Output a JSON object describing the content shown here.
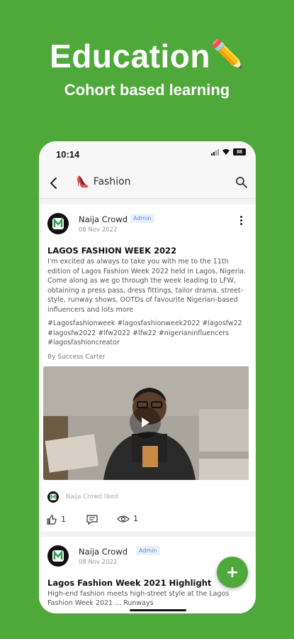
{
  "hero": {
    "title": "Education",
    "pencil": "✏️",
    "subtitle": "Cohort based learning"
  },
  "status_bar": {
    "time": "10:14",
    "battery": "88"
  },
  "app_bar": {
    "emoji": "👠",
    "title": "Fashion"
  },
  "posts": [
    {
      "author": "Naija Crowd",
      "badge": "Admin",
      "date": "08 Nov 2022",
      "title": "LAGOS FASHION WEEK 2022",
      "body": "I'm excited as always to take you with me to the 11th edition of Lagos Fashion Week 2022 held in Lagos, Nigeria. Come along as we go through the week leading to LFW, obtaining a press pass, dress fittings, tailor drama, street-style, runway shows, OOTDs of favourite Nigerian-based influencers and lots more",
      "tags": "#Lagosfashionweek #lagosfashionweek2022 #lagosfw22 #lagosfw2022 #lfw2022 #lfw22 #nigerianinfluencers #lagosfashioncreator",
      "byline": "By Success Carter",
      "liked_by": "Naija Crowd liked",
      "likes": "1",
      "views": "1"
    },
    {
      "author": "Naija Crowd",
      "badge": "Admin",
      "date": "08 Nov 2022",
      "title": "Lagos Fashion Week 2021 Highlight",
      "body": "High-end fashion meets high-street style at the Lagos Fashion Week 2021 ... Runways"
    }
  ],
  "fab": {
    "label": "+"
  },
  "colors": {
    "brand_green": "#4fa83a",
    "admin_badge": "#5b8fd8"
  }
}
